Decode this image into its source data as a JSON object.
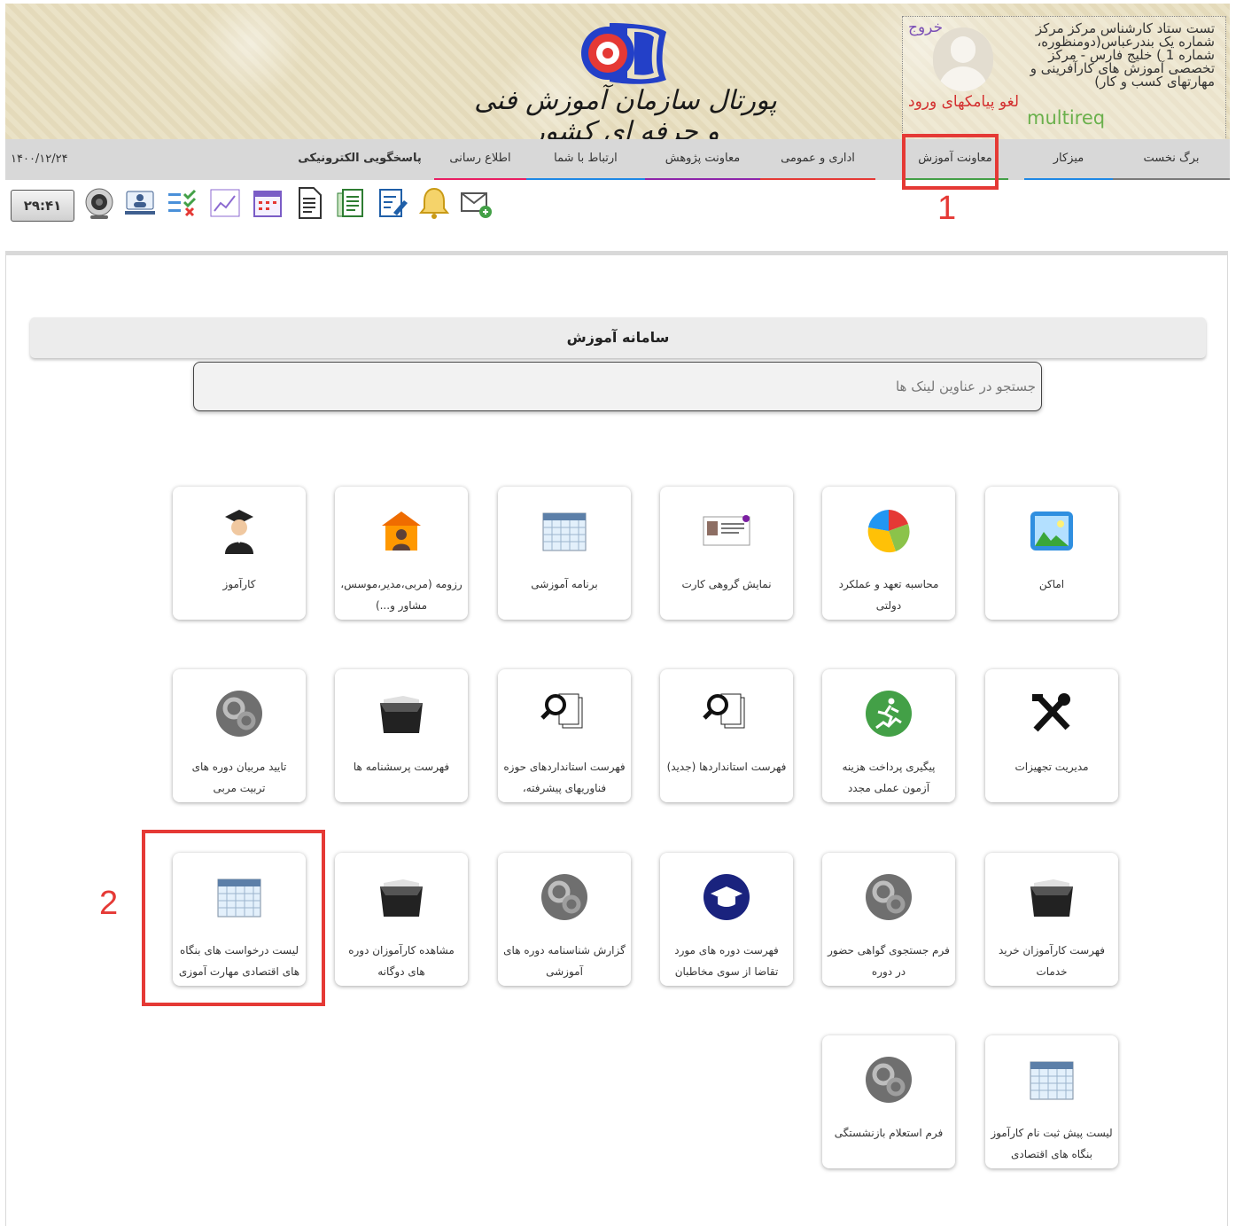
{
  "header": {
    "portal_title": "پورتال سازمان آموزش فنی و حرفه ای کشور",
    "logout": "خروج",
    "user_info": "تست ستاد کارشناس مرکز مرکز شماره یک بندرعباس(دومنظوره، شماره 1 ) خلیج فارس - مرکز تخصصی آموزش های کارآفرینی و مهارتهای کسب و کار)",
    "sms_link": "لغو پیامکهای ورود",
    "multireq": "multireq"
  },
  "nav": {
    "items": [
      {
        "label": "برگ نخست",
        "underline": "#7a7a7a"
      },
      {
        "label": "میزکار",
        "underline": "#1e88e5"
      },
      {
        "label": "معاونت آموزش",
        "underline": "#43a047"
      },
      {
        "label": "اداری و عمومی",
        "underline": "#e53935"
      },
      {
        "label": "معاونت پژوهش",
        "underline": "#8e24aa"
      },
      {
        "label": "ارتباط با شما",
        "underline": "#1e88e5"
      },
      {
        "label": "اطلاع رسانی",
        "underline": "#e91e63"
      },
      {
        "label": "پاسخگویی الکترونیکی",
        "underline": ""
      }
    ],
    "date": "۱۴۰۰/۱۲/۲۴"
  },
  "callouts": {
    "first": "1",
    "second": "2"
  },
  "toolbar": {
    "clock": "۲۹:۴۱",
    "icons": [
      "mail-icon",
      "bell-icon",
      "edit-note-icon",
      "documents-icon",
      "document-icon",
      "calendar-icon",
      "chart-icon",
      "checklist-icon",
      "user-screen-icon",
      "webcam-icon"
    ]
  },
  "section": {
    "title": "سامانه آموزش",
    "search_placeholder": "جستجو در عناوین لینک ها"
  },
  "tiles": [
    {
      "label": "اماکن",
      "icon": "landscape-icon"
    },
    {
      "label": "محاسبه تعهد و عملکرد دولتی",
      "icon": "pie-chart-icon"
    },
    {
      "label": "نمایش گروهی کارت",
      "icon": "id-card-icon"
    },
    {
      "label": "برنامه آموزشی",
      "icon": "calendar-icon"
    },
    {
      "label": "رزومه (مربی،مدیر،موسس، مشاور و...)",
      "icon": "instructor-icon"
    },
    {
      "label": "کارآموز",
      "icon": "graduate-icon"
    },
    {
      "label": "مدیریت تجهیزات",
      "icon": "tools-icon"
    },
    {
      "label": "پیگیری پرداخت هزینه آزمون عملی مجدد",
      "icon": "runner-icon"
    },
    {
      "label": "فهرست استانداردها (جدید)",
      "icon": "search-docs-icon"
    },
    {
      "label": "فهرست استانداردهای حوزه فناوریهای پیشرفته،",
      "icon": "search-docs-icon"
    },
    {
      "label": "فهرست پرسشنامه ها",
      "icon": "folder-icon"
    },
    {
      "label": "تایید مربیان دوره های تربیت مربی",
      "icon": "gears-icon"
    },
    {
      "label": "فهرست کارآموزان خرید خدمات",
      "icon": "folder-icon"
    },
    {
      "label": "فرم جستجوی گواهی حضور در دوره",
      "icon": "gears-icon"
    },
    {
      "label": "فهرست دوره های مورد تقاضا از سوی مخاطبان",
      "icon": "graduation-cap-icon"
    },
    {
      "label": "گزارش شناسنامه دوره های آموزشی",
      "icon": "gears-icon"
    },
    {
      "label": "مشاهده کارآموزان دوره های دوگانه",
      "icon": "folder-icon"
    },
    {
      "label": "لیست درخواست های بنگاه های اقتصادی مهارت آموزی",
      "icon": "calendar-icon"
    },
    {
      "label": "لیست پیش ثبت نام کارآموز بنگاه های اقتصادی",
      "icon": "calendar-icon"
    },
    {
      "label": "فرم استعلام بازنشستگی",
      "icon": "gears-icon"
    }
  ]
}
